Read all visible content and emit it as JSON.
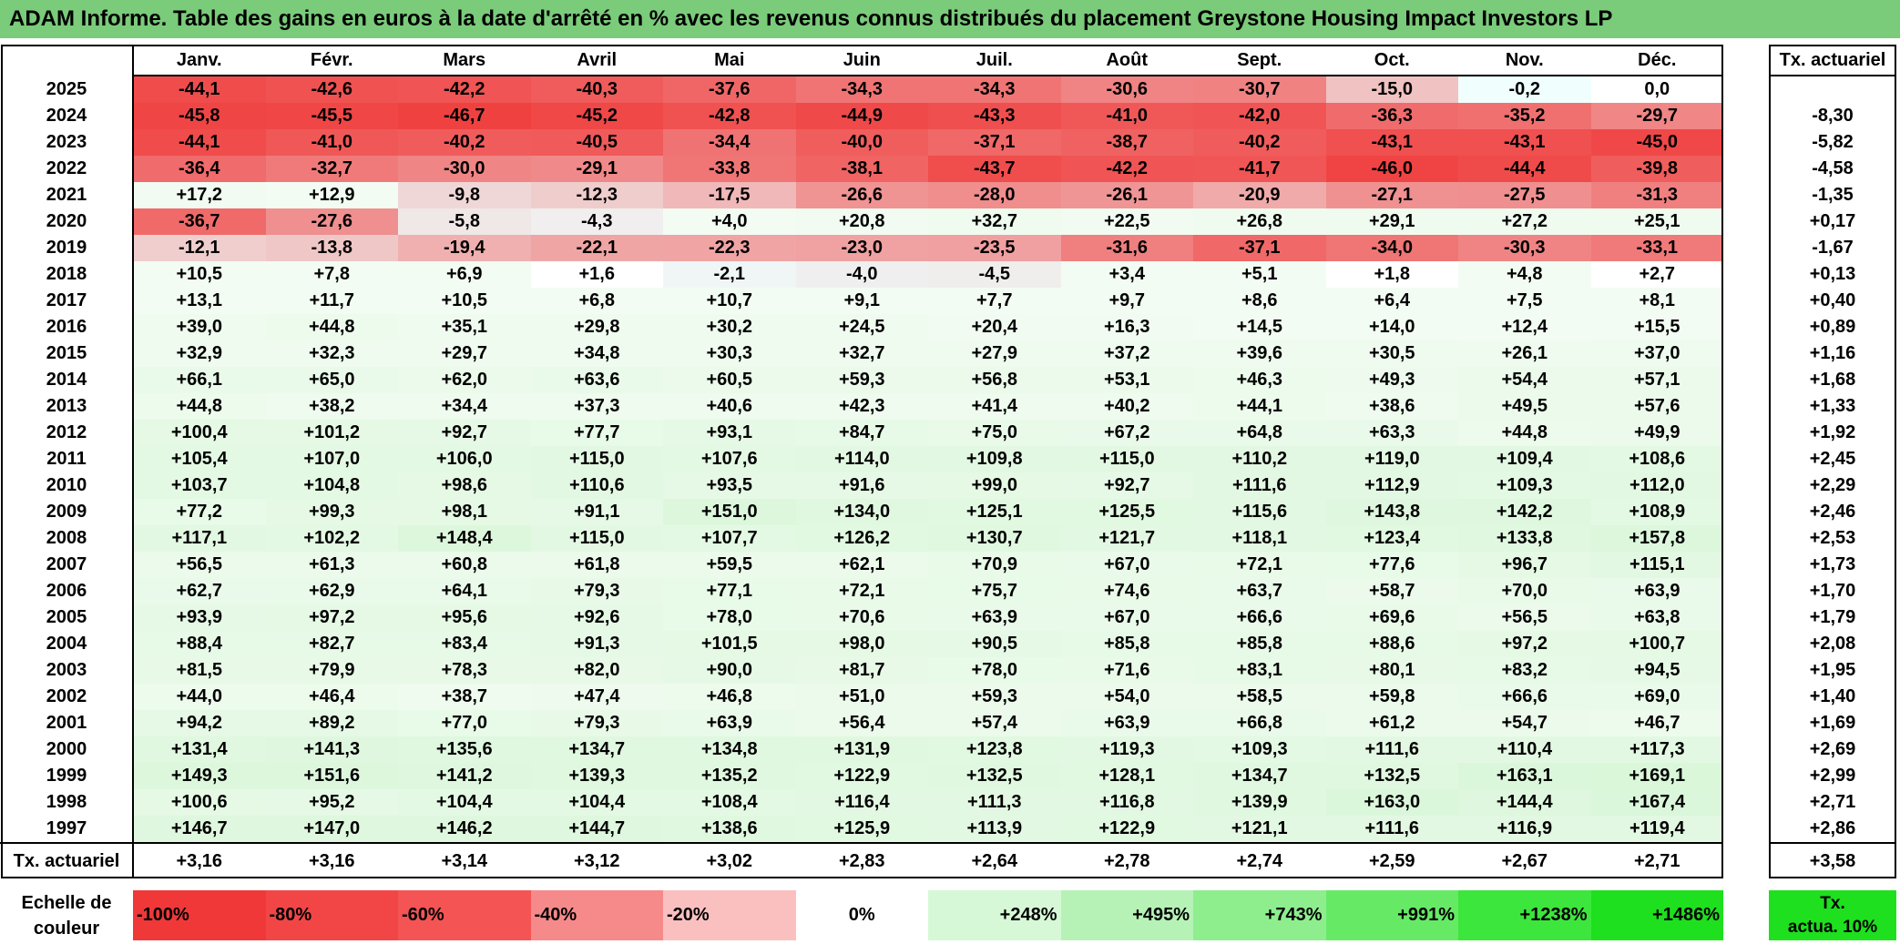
{
  "title": "ADAM Informe. Table des gains en euros à la date d'arrêté en % avec les revenus connus distribués du placement Greystone Housing Impact Investors LP",
  "months": [
    "Janv.",
    "Févr.",
    "Mars",
    "Avril",
    "Mai",
    "Juin",
    "Juil.",
    "Août",
    "Sept.",
    "Oct.",
    "Nov.",
    "Déc."
  ],
  "rate_header": "Tx. actuariel",
  "rows": [
    {
      "year": "2025",
      "values": [
        "-44,1",
        "-42,6",
        "-42,2",
        "-40,3",
        "-37,6",
        "-34,3",
        "-34,3",
        "-30,6",
        "-30,7",
        "-15,0",
        "-0,2",
        "0,0"
      ],
      "rate": ""
    },
    {
      "year": "2024",
      "values": [
        "-45,8",
        "-45,5",
        "-46,7",
        "-45,2",
        "-42,8",
        "-44,9",
        "-43,3",
        "-41,0",
        "-42,0",
        "-36,3",
        "-35,2",
        "-29,7"
      ],
      "rate": "-8,30"
    },
    {
      "year": "2023",
      "values": [
        "-44,1",
        "-41,0",
        "-40,2",
        "-40,5",
        "-34,4",
        "-40,0",
        "-37,1",
        "-38,7",
        "-40,2",
        "-43,1",
        "-43,1",
        "-45,0"
      ],
      "rate": "-5,82"
    },
    {
      "year": "2022",
      "values": [
        "-36,4",
        "-32,7",
        "-30,0",
        "-29,1",
        "-33,8",
        "-38,1",
        "-43,7",
        "-42,2",
        "-41,7",
        "-46,0",
        "-44,4",
        "-39,8"
      ],
      "rate": "-4,58"
    },
    {
      "year": "2021",
      "values": [
        "+17,2",
        "+12,9",
        "-9,8",
        "-12,3",
        "-17,5",
        "-26,6",
        "-28,0",
        "-26,1",
        "-20,9",
        "-27,1",
        "-27,5",
        "-31,3"
      ],
      "rate": "-1,35"
    },
    {
      "year": "2020",
      "values": [
        "-36,7",
        "-27,6",
        "-5,8",
        "-4,3",
        "+4,0",
        "+20,8",
        "+32,7",
        "+22,5",
        "+26,8",
        "+29,1",
        "+27,2",
        "+25,1"
      ],
      "rate": "+0,17"
    },
    {
      "year": "2019",
      "values": [
        "-12,1",
        "-13,8",
        "-19,4",
        "-22,1",
        "-22,3",
        "-23,0",
        "-23,5",
        "-31,6",
        "-37,1",
        "-34,0",
        "-30,3",
        "-33,1"
      ],
      "rate": "-1,67"
    },
    {
      "year": "2018",
      "values": [
        "+10,5",
        "+7,8",
        "+6,9",
        "+1,6",
        "-2,1",
        "-4,0",
        "-4,5",
        "+3,4",
        "+5,1",
        "+1,8",
        "+4,8",
        "+2,7"
      ],
      "rate": "+0,13"
    },
    {
      "year": "2017",
      "values": [
        "+13,1",
        "+11,7",
        "+10,5",
        "+6,8",
        "+10,7",
        "+9,1",
        "+7,7",
        "+9,7",
        "+8,6",
        "+6,4",
        "+7,5",
        "+8,1"
      ],
      "rate": "+0,40"
    },
    {
      "year": "2016",
      "values": [
        "+39,0",
        "+44,8",
        "+35,1",
        "+29,8",
        "+30,2",
        "+24,5",
        "+20,4",
        "+16,3",
        "+14,5",
        "+14,0",
        "+12,4",
        "+15,5"
      ],
      "rate": "+0,89"
    },
    {
      "year": "2015",
      "values": [
        "+32,9",
        "+32,3",
        "+29,7",
        "+34,8",
        "+30,3",
        "+32,7",
        "+27,9",
        "+37,2",
        "+39,6",
        "+30,5",
        "+26,1",
        "+37,0"
      ],
      "rate": "+1,16"
    },
    {
      "year": "2014",
      "values": [
        "+66,1",
        "+65,0",
        "+62,0",
        "+63,6",
        "+60,5",
        "+59,3",
        "+56,8",
        "+53,1",
        "+46,3",
        "+49,3",
        "+54,4",
        "+57,1"
      ],
      "rate": "+1,68"
    },
    {
      "year": "2013",
      "values": [
        "+44,8",
        "+38,2",
        "+34,4",
        "+37,3",
        "+40,6",
        "+42,3",
        "+41,4",
        "+40,2",
        "+44,1",
        "+38,6",
        "+49,5",
        "+57,6"
      ],
      "rate": "+1,33"
    },
    {
      "year": "2012",
      "values": [
        "+100,4",
        "+101,2",
        "+92,7",
        "+77,7",
        "+93,1",
        "+84,7",
        "+75,0",
        "+67,2",
        "+64,8",
        "+63,3",
        "+44,8",
        "+49,9"
      ],
      "rate": "+1,92"
    },
    {
      "year": "2011",
      "values": [
        "+105,4",
        "+107,0",
        "+106,0",
        "+115,0",
        "+107,6",
        "+114,0",
        "+109,8",
        "+115,0",
        "+110,2",
        "+119,0",
        "+109,4",
        "+108,6"
      ],
      "rate": "+2,45"
    },
    {
      "year": "2010",
      "values": [
        "+103,7",
        "+104,8",
        "+98,6",
        "+110,6",
        "+93,5",
        "+91,6",
        "+99,0",
        "+92,7",
        "+111,6",
        "+112,9",
        "+109,3",
        "+112,0"
      ],
      "rate": "+2,29"
    },
    {
      "year": "2009",
      "values": [
        "+77,2",
        "+99,3",
        "+98,1",
        "+91,1",
        "+151,0",
        "+134,0",
        "+125,1",
        "+125,5",
        "+115,6",
        "+143,8",
        "+142,2",
        "+108,9"
      ],
      "rate": "+2,46"
    },
    {
      "year": "2008",
      "values": [
        "+117,1",
        "+102,2",
        "+148,4",
        "+115,0",
        "+107,7",
        "+126,2",
        "+130,7",
        "+121,7",
        "+118,1",
        "+123,4",
        "+133,8",
        "+157,8"
      ],
      "rate": "+2,53"
    },
    {
      "year": "2007",
      "values": [
        "+56,5",
        "+61,3",
        "+60,8",
        "+61,8",
        "+59,5",
        "+62,1",
        "+70,9",
        "+67,0",
        "+72,1",
        "+77,6",
        "+96,7",
        "+115,1"
      ],
      "rate": "+1,73"
    },
    {
      "year": "2006",
      "values": [
        "+62,7",
        "+62,9",
        "+64,1",
        "+79,3",
        "+77,1",
        "+72,1",
        "+75,7",
        "+74,6",
        "+63,7",
        "+58,7",
        "+70,0",
        "+63,9"
      ],
      "rate": "+1,70"
    },
    {
      "year": "2005",
      "values": [
        "+93,9",
        "+97,2",
        "+95,6",
        "+92,6",
        "+78,0",
        "+70,6",
        "+63,9",
        "+67,0",
        "+66,6",
        "+69,6",
        "+56,5",
        "+63,8"
      ],
      "rate": "+1,79"
    },
    {
      "year": "2004",
      "values": [
        "+88,4",
        "+82,7",
        "+83,4",
        "+91,3",
        "+101,5",
        "+98,0",
        "+90,5",
        "+85,8",
        "+85,8",
        "+88,6",
        "+97,2",
        "+100,7"
      ],
      "rate": "+2,08"
    },
    {
      "year": "2003",
      "values": [
        "+81,5",
        "+79,9",
        "+78,3",
        "+82,0",
        "+90,0",
        "+81,7",
        "+78,0",
        "+71,6",
        "+83,1",
        "+80,1",
        "+83,2",
        "+94,5"
      ],
      "rate": "+1,95"
    },
    {
      "year": "2002",
      "values": [
        "+44,0",
        "+46,4",
        "+38,7",
        "+47,4",
        "+46,8",
        "+51,0",
        "+59,3",
        "+54,0",
        "+58,5",
        "+59,8",
        "+66,6",
        "+69,0"
      ],
      "rate": "+1,40"
    },
    {
      "year": "2001",
      "values": [
        "+94,2",
        "+89,2",
        "+77,0",
        "+79,3",
        "+63,9",
        "+56,4",
        "+57,4",
        "+63,9",
        "+66,8",
        "+61,2",
        "+54,7",
        "+46,7"
      ],
      "rate": "+1,69"
    },
    {
      "year": "2000",
      "values": [
        "+131,4",
        "+141,3",
        "+135,6",
        "+134,7",
        "+134,8",
        "+131,9",
        "+123,8",
        "+119,3",
        "+109,3",
        "+111,6",
        "+110,4",
        "+117,3"
      ],
      "rate": "+2,69"
    },
    {
      "year": "1999",
      "values": [
        "+149,3",
        "+151,6",
        "+141,2",
        "+139,3",
        "+135,2",
        "+122,9",
        "+132,5",
        "+128,1",
        "+134,7",
        "+132,5",
        "+163,1",
        "+169,1"
      ],
      "rate": "+2,99"
    },
    {
      "year": "1998",
      "values": [
        "+100,6",
        "+95,2",
        "+104,4",
        "+104,4",
        "+108,4",
        "+116,4",
        "+111,3",
        "+116,8",
        "+139,9",
        "+163,0",
        "+144,4",
        "+167,4"
      ],
      "rate": "+2,71"
    },
    {
      "year": "1997",
      "values": [
        "+146,7",
        "+147,0",
        "+146,2",
        "+144,7",
        "+138,6",
        "+125,9",
        "+113,9",
        "+122,9",
        "+121,1",
        "+111,6",
        "+116,9",
        "+119,4"
      ],
      "rate": "+2,86"
    }
  ],
  "summary": {
    "label": "Tx. actuariel",
    "values": [
      "+3,16",
      "+3,16",
      "+3,14",
      "+3,12",
      "+3,02",
      "+2,83",
      "+2,64",
      "+2,78",
      "+2,74",
      "+2,59",
      "+2,67",
      "+2,71"
    ],
    "rate": "+3,58"
  },
  "legend": {
    "label_line1": "Echelle de",
    "label_line2": "couleur",
    "steps": [
      "-100%",
      "-80%",
      "-60%",
      "-40%",
      "-20%",
      "0%",
      "+248%",
      "+495%",
      "+743%",
      "+991%",
      "+1238%",
      "+1486%"
    ],
    "step_colors": [
      "#f03838",
      "#f24646",
      "#f45454",
      "#f68a8a",
      "#fac0c0",
      "#ffffff",
      "#d6f8d6",
      "#b6f2b6",
      "#8eee8e",
      "#66ea66",
      "#3ce63c",
      "#1ee01e"
    ],
    "rate_line1": "Tx.",
    "rate_line2": "actua. 10%",
    "rate_color": "#1ee01e"
  },
  "colors": {
    "title_bar": "#7acb7a",
    "border": "#000000"
  }
}
